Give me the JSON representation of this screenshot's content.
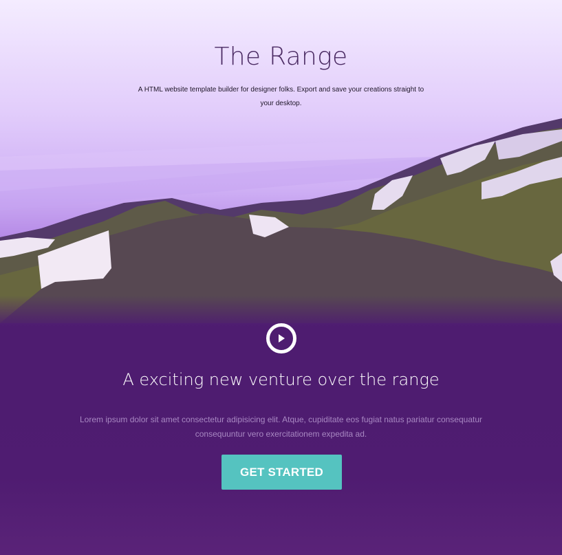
{
  "hero": {
    "title": "The Range",
    "subtitle": "A HTML website template builder for designer folks. Export and save your creations straight to your desktop."
  },
  "content": {
    "play_icon": "play-circle-icon",
    "heading": "A exciting new venture over the range",
    "body": "Lorem ipsum dolor sit amet consectetur adipisicing elit. Atque, cupiditate eos fugiat natus pariatur consequatur consequuntur vero exercitationem expedita ad.",
    "cta_label": "GET STARTED"
  },
  "colors": {
    "background": "#4e1c70",
    "accent": "#55c3c0",
    "title_text": "#4a2a62",
    "body_text": "#a888c2"
  }
}
